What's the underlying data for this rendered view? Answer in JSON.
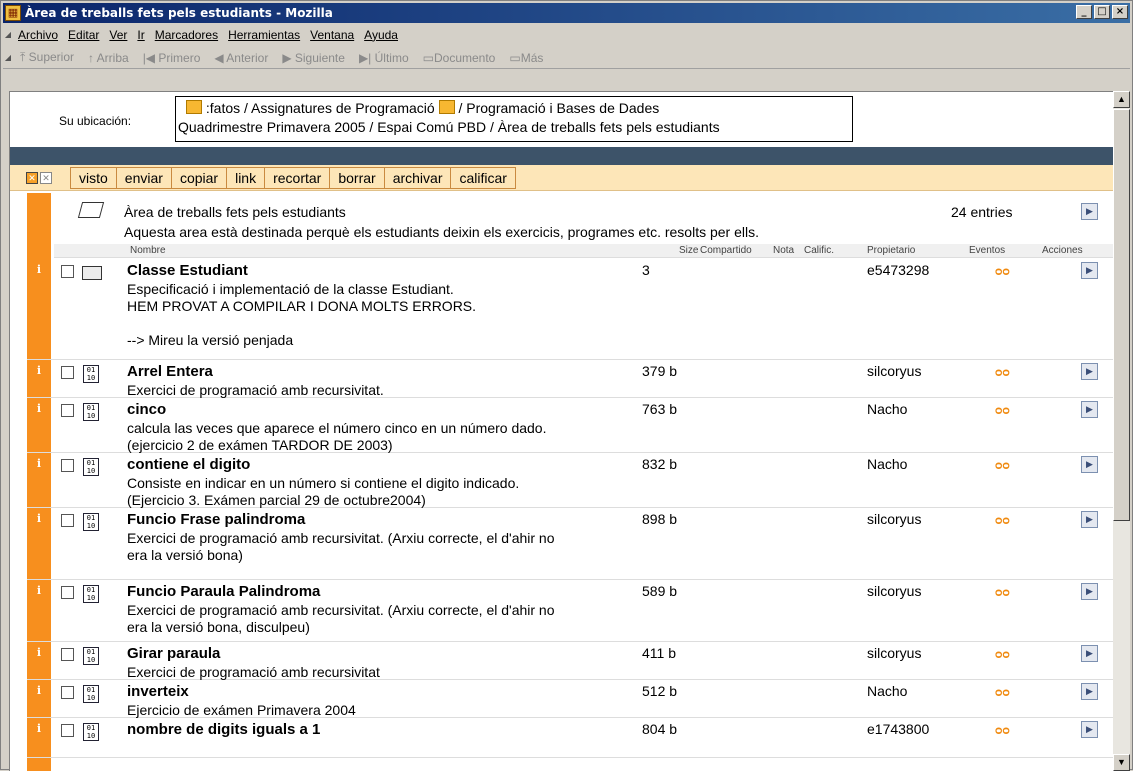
{
  "window": {
    "title": "Àrea de treballs fets pels estudiants - Mozilla"
  },
  "menubar": [
    "Archivo",
    "Editar",
    "Ver",
    "Ir",
    "Marcadores",
    "Herramientas",
    "Ventana",
    "Ayuda"
  ],
  "navbar": [
    "Superior",
    "Arriba",
    "Primero",
    "Anterior",
    "Siguiente",
    "Último",
    "Documento",
    "Más"
  ],
  "location": {
    "label": "Su ubicación:",
    "line1a": ":fatos / Assignatures de Programació",
    "line1b": "/ Programació i Bases de Dades",
    "line2": "Quadrimestre Primavera 2005 / Espai Comú PBD / Àrea de treballs fets pels estudiants"
  },
  "actions": [
    "visto",
    "enviar",
    "copiar",
    "link",
    "recortar",
    "borrar",
    "archivar",
    "calificar"
  ],
  "folder": {
    "title": "Àrea de treballs fets pels estudiants",
    "description": "Aquesta area està destinada perquè els estudiants deixin els exercicis, programes etc. resolts per ells.",
    "entries": "24 entries"
  },
  "columns": {
    "name": "Nombre",
    "size": "Size",
    "shared": "Compartido",
    "note": "Nota",
    "grade": "Calific.",
    "owner": "Propietario",
    "events": "Eventos",
    "actions": "Acciones"
  },
  "rows": [
    {
      "name": "Classe Estudiant",
      "desc": "Especificació i implementació de la classe Estudiant.\nHEM PROVAT A COMPILAR I DONA MOLTS ERRORS.\n\n--> Mireu la versió penjada",
      "size": "3",
      "owner": "e5473298",
      "type": "folder"
    },
    {
      "name": "Arrel Entera",
      "desc": "Exercici de programació amb recursivitat.",
      "size": "379 b",
      "owner": "silcoryus",
      "type": "file"
    },
    {
      "name": "cinco",
      "desc": "calcula las veces que aparece el número cinco en un número dado.\n(ejercicio 2 de exámen TARDOR DE 2003)",
      "size": "763 b",
      "owner": "Nacho",
      "type": "file"
    },
    {
      "name": "contiene el digito",
      "desc": "Consiste en indicar en un número si contiene el digito indicado.\n(Ejercicio 3. Exámen parcial 29 de octubre2004)",
      "size": "832 b",
      "owner": "Nacho",
      "type": "file"
    },
    {
      "name": "Funcio Frase palindroma",
      "desc": "Exercici de programació amb recursivitat. (Arxiu correcte, el d'ahir no\nera la versió bona)",
      "size": "898 b",
      "owner": "silcoryus",
      "type": "file"
    },
    {
      "name": "Funcio Paraula Palindroma",
      "desc": "Exercici de programació amb recursivitat. (Arxiu correcte, el d'ahir no\nera la versió bona, disculpeu)",
      "size": "589 b",
      "owner": "silcoryus",
      "type": "file"
    },
    {
      "name": "Girar paraula",
      "desc": "Exercici de programació amb recursivitat",
      "size": "411 b",
      "owner": "silcoryus",
      "type": "file"
    },
    {
      "name": "inverteix",
      "desc": "Ejercicio de exámen Primavera 2004",
      "size": "512 b",
      "owner": "Nacho",
      "type": "file"
    },
    {
      "name": "nombre de digits iguals a 1",
      "desc": "",
      "size": "804 b",
      "owner": "e1743800",
      "type": "file"
    }
  ]
}
